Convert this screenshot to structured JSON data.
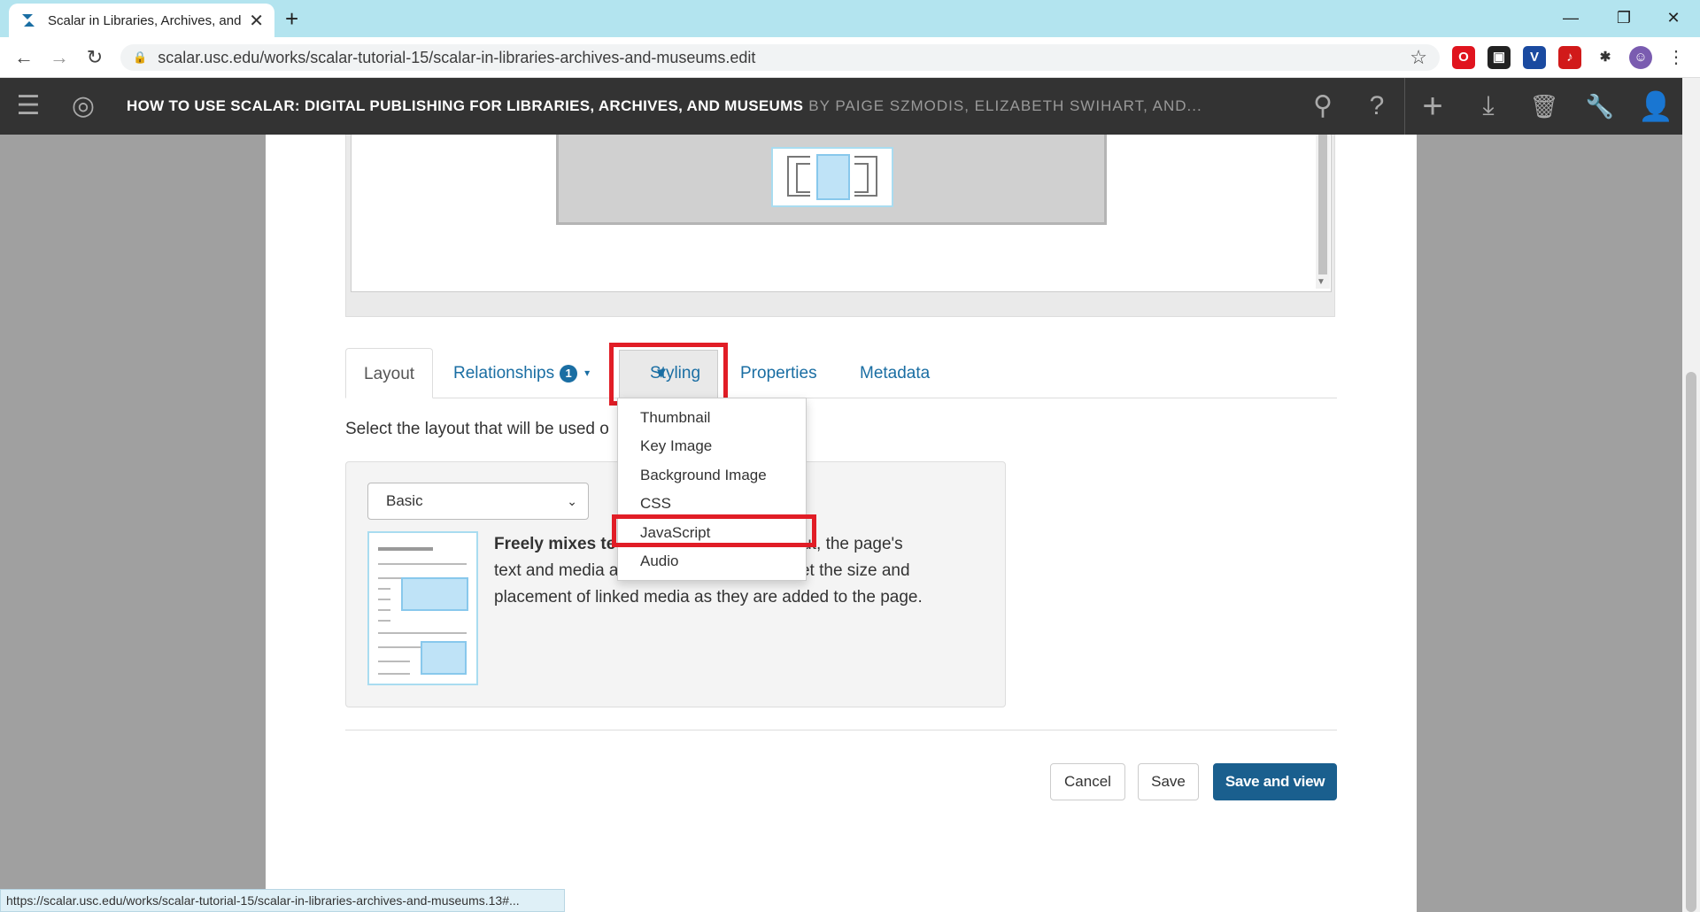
{
  "browser": {
    "tab_title": "Scalar in Libraries, Archives, and M",
    "tab_close": "✕",
    "new_tab": "+",
    "minimize": "—",
    "restore": "❐",
    "close": "✕",
    "url": "scalar.usc.edu/works/scalar-tutorial-15/scalar-in-libraries-archives-and-museums.edit",
    "back": "←",
    "forward": "→",
    "reload": "↻",
    "bookmark": "☆"
  },
  "extensions": [
    {
      "name": "opera-extension",
      "glyph": "O",
      "color": "#e0141e"
    },
    {
      "name": "lock-extension",
      "glyph": "▣",
      "color": "#222222"
    },
    {
      "name": "v-extension",
      "glyph": "V",
      "color": "#1a4aa0"
    },
    {
      "name": "music-extension",
      "glyph": "♪",
      "color": "#d11a1a"
    },
    {
      "name": "puzzle-extension",
      "glyph": "✱",
      "color": "#333333"
    },
    {
      "name": "profile",
      "glyph": "☺",
      "color": "#7a5cb0"
    }
  ],
  "scalar": {
    "title": "HOW TO USE SCALAR: DIGITAL PUBLISHING FOR LIBRARIES, ARCHIVES, AND MUSEUMS",
    "byline": "BY PAIGE SZMODIS, ELIZABETH SWIHART, AND...",
    "icons": {
      "menu": "☰",
      "compass": "◎",
      "search": "⚲",
      "help": "?",
      "add": "+",
      "import": "⤓",
      "delete": "🗑",
      "tools": "🔧",
      "user": "👤"
    }
  },
  "tabs": {
    "layout": "Layout",
    "relationships": "Relationships",
    "relationships_count": "1",
    "styling": "Styling",
    "properties": "Properties",
    "metadata": "Metadata",
    "caret": "▾"
  },
  "styling_menu": [
    "Thumbnail",
    "Key Image",
    "Background Image",
    "CSS",
    "JavaScript",
    "Audio"
  ],
  "layout_panel": {
    "label": "Select the layout that will be used o",
    "select_value": "Basic",
    "select_chevron": "⌄",
    "desc_bold": "Freely mixes te",
    "desc_line1": "layout, the page's",
    "desc_line2_a": "text and media a",
    "desc_line2_b": "set the size and",
    "desc_line3": "placement of linked media as they are added to the page."
  },
  "buttons": {
    "cancel": "Cancel",
    "save": "Save",
    "save_and_view": "Save and view"
  },
  "status_url": "https://scalar.usc.edu/works/scalar-tutorial-15/scalar-in-libraries-archives-and-museums.13#..."
}
